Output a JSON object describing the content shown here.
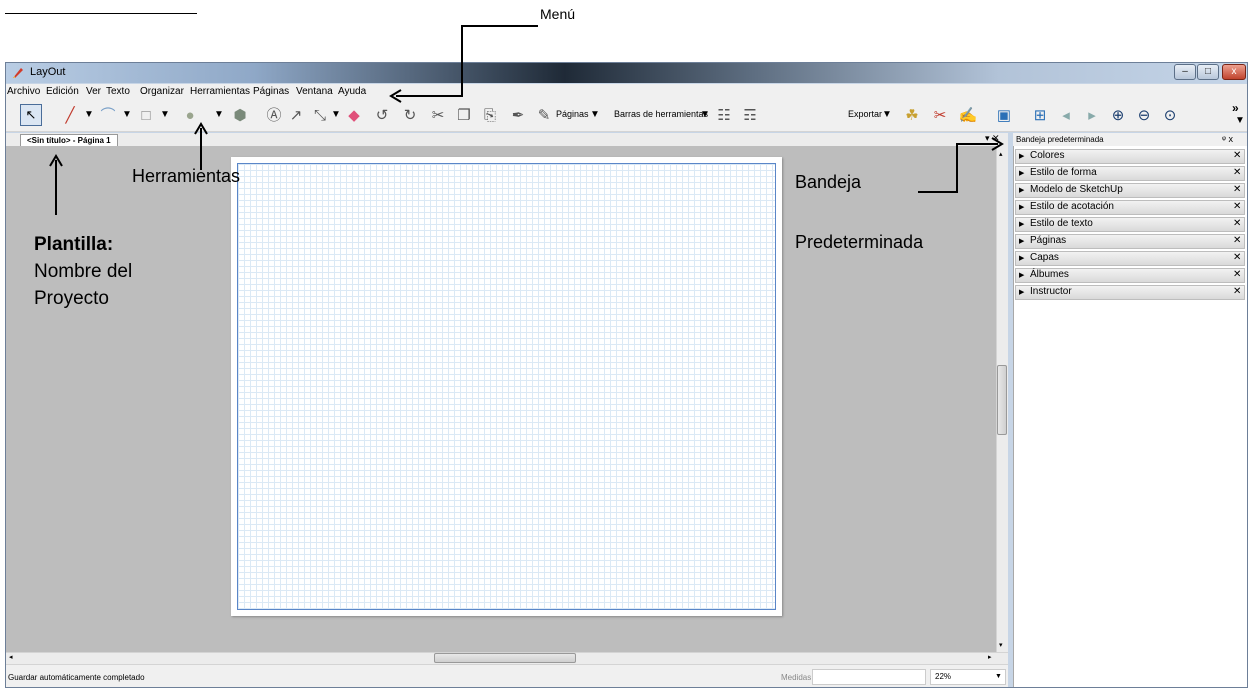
{
  "top_callout": {
    "label": "Menú"
  },
  "window": {
    "title": "LayOut",
    "min": "–",
    "max": "□",
    "close": "x"
  },
  "menubar": [
    "Archivo",
    "Edición",
    "Ver",
    "Texto",
    "Organizar",
    "Herramientas",
    "Páginas",
    "Ventana",
    "Ayuda"
  ],
  "toolbar": {
    "pages_label": "Páginas",
    "toolbars_label": "Barras de herramientas",
    "export_label": "Exportar",
    "more": "»"
  },
  "document": {
    "tab_label": "<Sin título> - Página 1",
    "close": "x"
  },
  "status": {
    "text": "Guardar automáticamente completado",
    "measures_label": "Medidas",
    "zoom": "22%"
  },
  "tray": {
    "title": "Bandeja predeterminada",
    "pin": "ᵠ x",
    "items": [
      "Colores",
      "Estilo de forma",
      "Modelo de SketchUp",
      "Estilo de acotación",
      "Estilo de texto",
      "Páginas",
      "Capas",
      "Álbumes",
      "Instructor"
    ]
  },
  "annotations": {
    "herramientas": "Herramientas",
    "plantilla_bold": "Plantilla:",
    "plantilla_line2": "Nombre del",
    "plantilla_line3": "Proyecto",
    "bandeja_line1": "Bandeja",
    "bandeja_line2": "Predeterminada"
  }
}
